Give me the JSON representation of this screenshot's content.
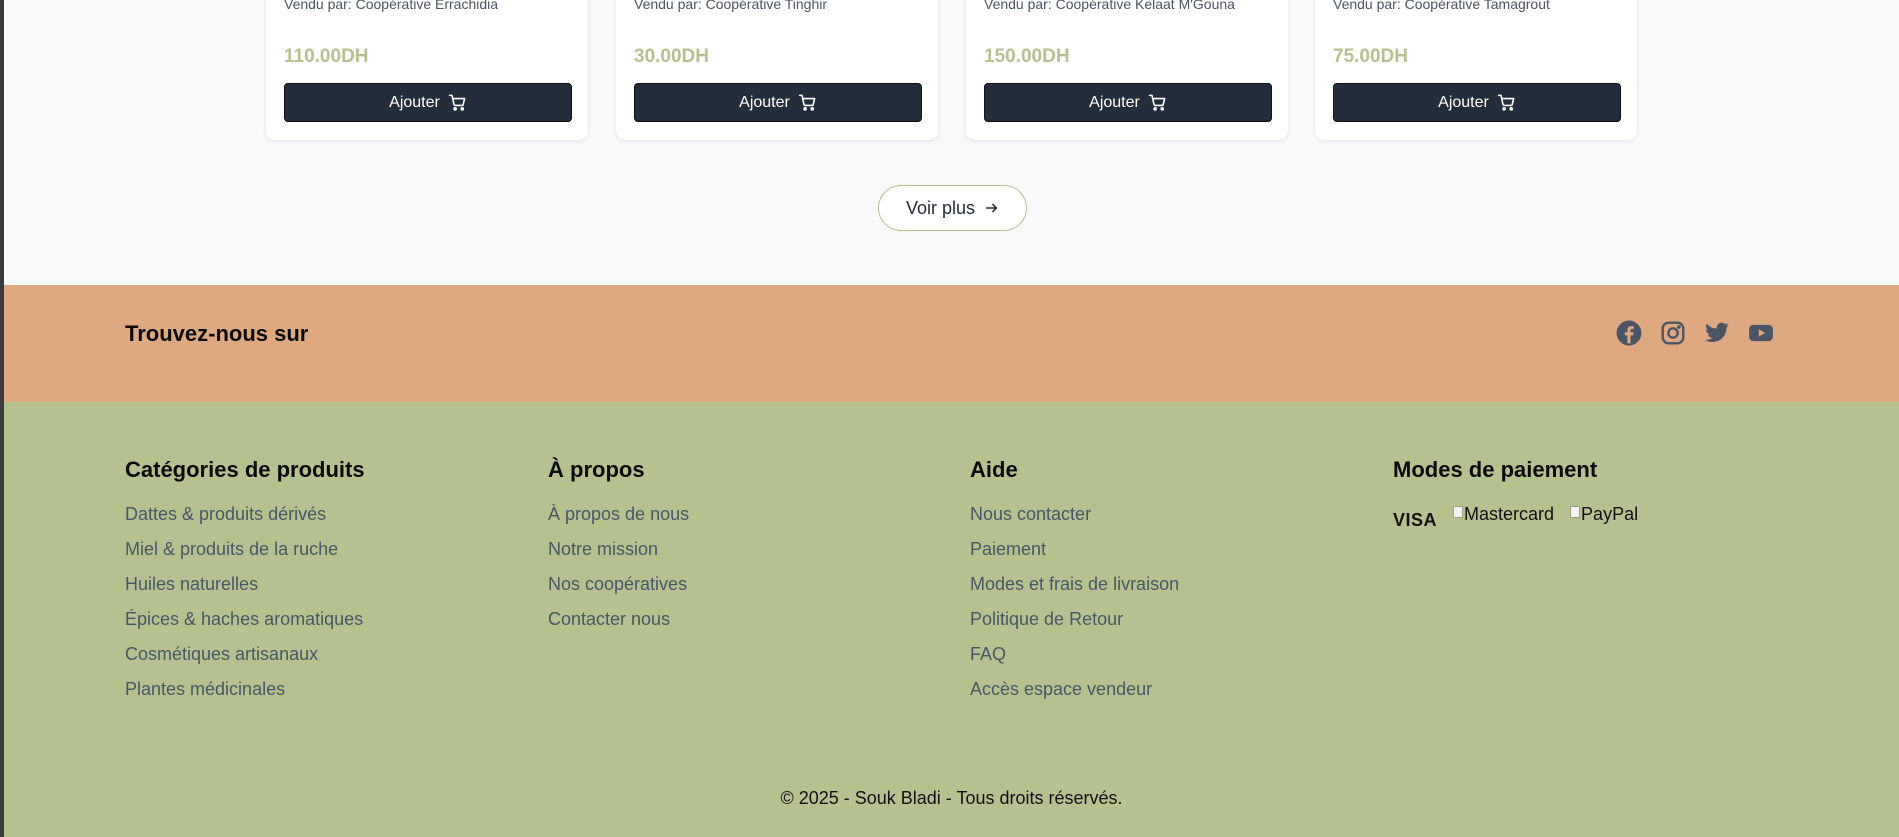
{
  "products": [
    {
      "seller": "Vendu par: Coopérative Errachidia",
      "price": "110.00DH",
      "button_label": "Ajouter"
    },
    {
      "seller": "Vendu par: Coopérative Tinghir",
      "price": "30.00DH",
      "button_label": "Ajouter"
    },
    {
      "seller": "Vendu par: Coopérative Kelaat M'Gouna",
      "price": "150.00DH",
      "button_label": "Ajouter"
    },
    {
      "seller": "Vendu par: Coopérative Tamagrout",
      "price": "75.00DH",
      "button_label": "Ajouter"
    }
  ],
  "voir_plus_label": "Voir plus",
  "social": {
    "title": "Trouvez-nous sur",
    "icons": [
      "facebook-icon",
      "instagram-icon",
      "twitter-icon",
      "youtube-icon"
    ]
  },
  "footer": {
    "categories": {
      "title": "Catégories de produits",
      "items": [
        "Dattes & produits dérivés",
        "Miel & produits de la ruche",
        "Huiles naturelles",
        "Épices & haches aromatiques",
        "Cosmétiques artisanaux",
        "Plantes médicinales"
      ]
    },
    "about": {
      "title": "À propos",
      "items": [
        "À propos de nous",
        "Notre mission",
        "Nos coopératives",
        "Contacter nous"
      ]
    },
    "help": {
      "title": "Aide",
      "items": [
        "Nous contacter",
        "Paiement",
        "Modes et frais de livraison",
        "Politique de Retour",
        "FAQ",
        "Accès espace vendeur"
      ]
    },
    "payment": {
      "title": "Modes de paiement",
      "visa": "VISA",
      "mastercard": "Mastercard",
      "paypal": "PayPal"
    },
    "copyright": "© 2025 - Souk Bladi - Tous droits réservés."
  },
  "colors": {
    "price_green": "#b5c18e",
    "button_dark": "#232d3b",
    "social_band": "#dea881",
    "footer_bg": "#b5c290"
  }
}
